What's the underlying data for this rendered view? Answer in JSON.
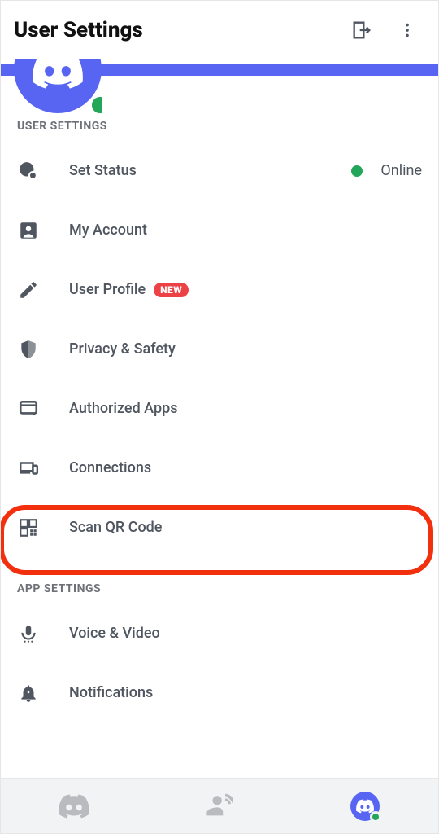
{
  "header": {
    "title": "User Settings"
  },
  "status": {
    "label": "Online"
  },
  "sections": {
    "user": {
      "heading": "USER SETTINGS",
      "items": {
        "set_status": "Set Status",
        "my_account": "My Account",
        "user_profile": "User Profile",
        "user_profile_badge": "NEW",
        "privacy_safety": "Privacy & Safety",
        "authorized_apps": "Authorized Apps",
        "connections": "Connections",
        "scan_qr": "Scan QR Code"
      }
    },
    "app": {
      "heading": "APP SETTINGS",
      "items": {
        "voice_video": "Voice & Video",
        "notifications": "Notifications"
      }
    }
  },
  "colors": {
    "accent": "#5865F2",
    "online": "#23a55a",
    "highlight": "#f2300d",
    "badge": "#ed4245"
  }
}
